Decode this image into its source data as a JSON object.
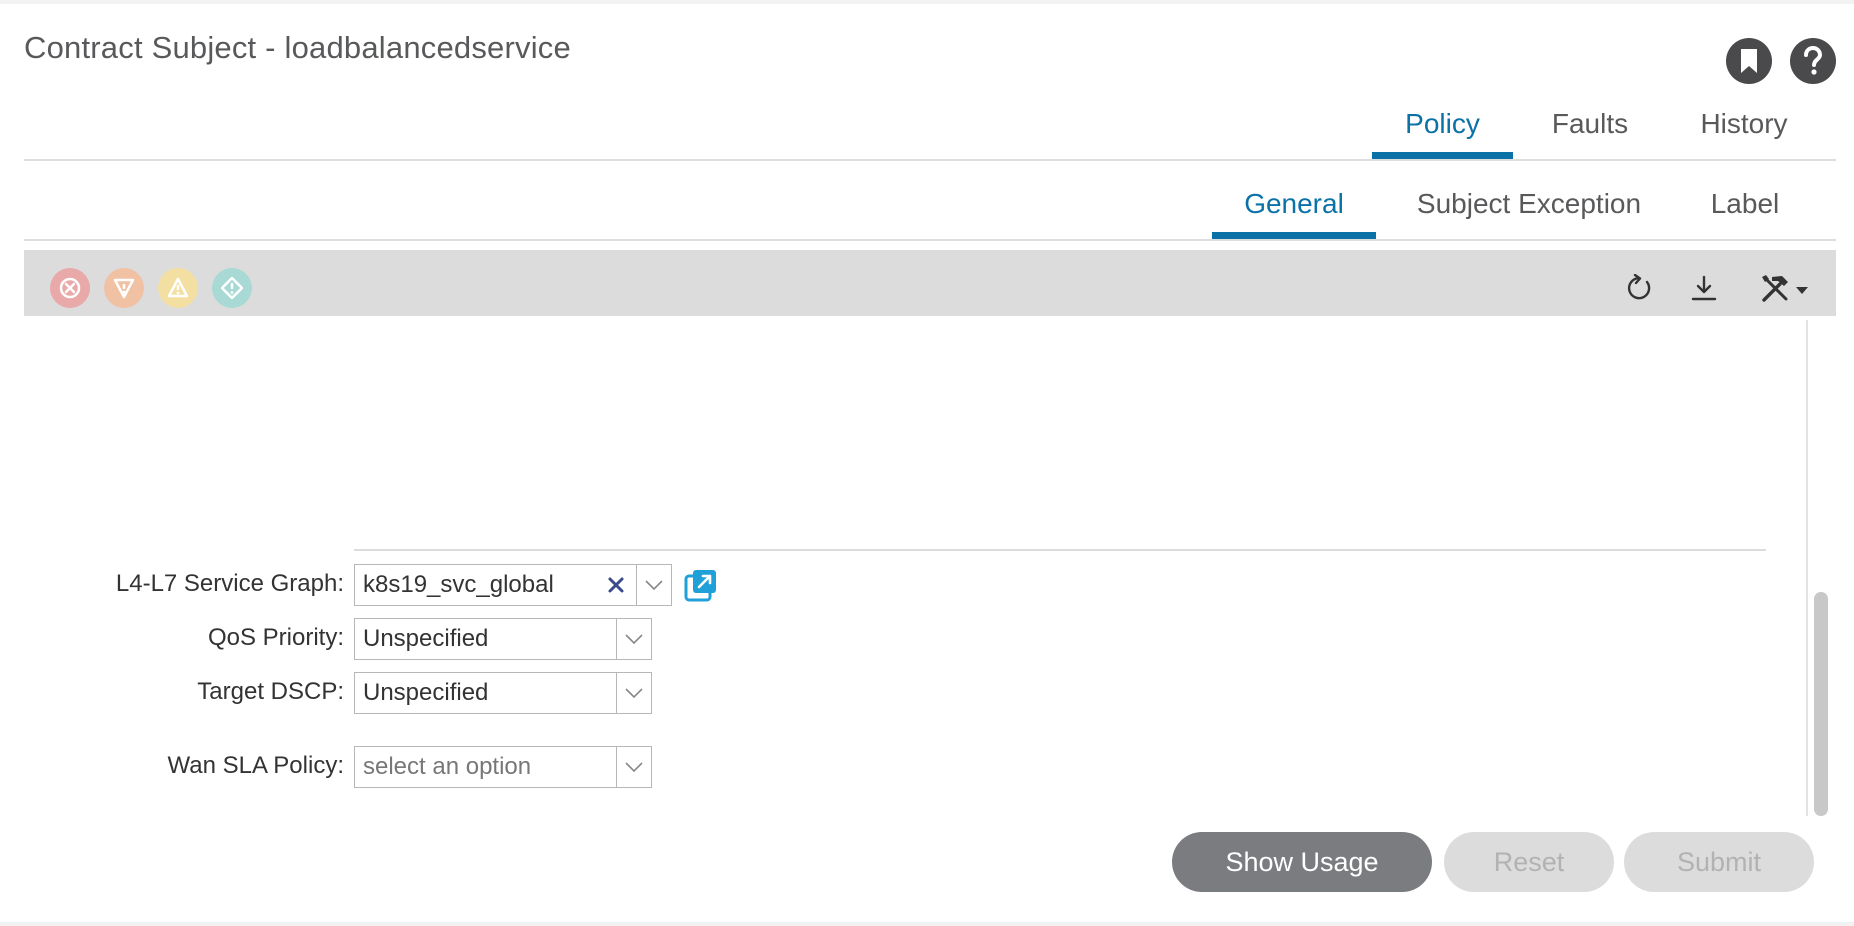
{
  "header": {
    "title": "Contract Subject - loadbalancedservice",
    "bookmark_icon": "bookmark-icon",
    "help_icon": "help-icon"
  },
  "main_tabs": [
    {
      "label": "Policy",
      "active": true
    },
    {
      "label": "Faults",
      "active": false
    },
    {
      "label": "History",
      "active": false
    }
  ],
  "sub_tabs": [
    {
      "label": "General",
      "active": true
    },
    {
      "label": "Subject Exception",
      "active": false
    },
    {
      "label": "Label",
      "active": false
    }
  ],
  "toolbar": {
    "fault_icons": [
      {
        "name": "critical-fault-icon",
        "color": "#e9a9a8"
      },
      {
        "name": "major-fault-icon",
        "color": "#f0c1a2"
      },
      {
        "name": "minor-fault-icon",
        "color": "#f4dfa2"
      },
      {
        "name": "warning-fault-icon",
        "color": "#a9d9d4"
      }
    ],
    "actions": [
      "refresh-icon",
      "download-icon",
      "tools-icon"
    ]
  },
  "form": {
    "service_graph": {
      "label": "L4-L7 Service Graph:",
      "value": "k8s19_svc_global"
    },
    "qos_priority": {
      "label": "QoS Priority:",
      "value": "Unspecified"
    },
    "target_dscp": {
      "label": "Target DSCP:",
      "value": "Unspecified"
    },
    "wan_sla_policy": {
      "label": "Wan SLA Policy:",
      "placeholder": "select an option"
    }
  },
  "footer": {
    "show_usage": "Show Usage",
    "reset": "Reset",
    "submit": "Submit"
  },
  "colors": {
    "accent": "#0b72a8",
    "primary_button": "#7b7c80",
    "disabled_button": "#dcdcdc",
    "link_icon": "#1fa0d8"
  }
}
